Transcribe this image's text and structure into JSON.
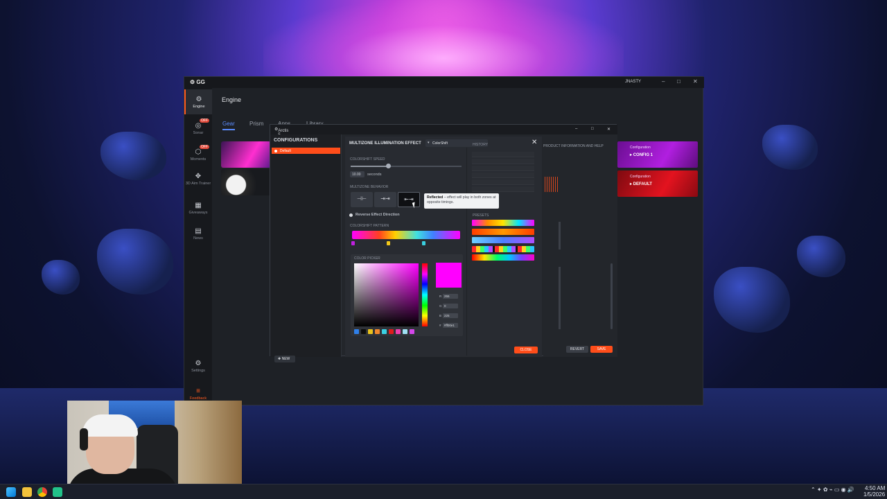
{
  "gg": {
    "logo": "GG",
    "user": "JNASTY",
    "window_controls": [
      "–",
      "□",
      "✕"
    ],
    "title": "Engine",
    "tabs": [
      "Gear",
      "Prism",
      "Apps",
      "Library"
    ],
    "nav": [
      {
        "label": "Engine",
        "icon": "engine-icon"
      },
      {
        "label": "Sonar",
        "icon": "sonar-icon",
        "badge": "OFF"
      },
      {
        "label": "Moments",
        "icon": "moments-icon",
        "badge": "OFF"
      },
      {
        "label": "3D Aim Trainer",
        "icon": "aim-trainer-icon"
      },
      {
        "label": "Giveaways",
        "icon": "gift-icon"
      },
      {
        "label": "News",
        "icon": "news-icon"
      },
      {
        "label": "Settings",
        "icon": "gear-icon"
      },
      {
        "label": "Feedback",
        "icon": "feedback-icon"
      }
    ],
    "config_cards": [
      {
        "label": "Configuration",
        "name": "CONFIG 1",
        "color": "#a21bd0"
      },
      {
        "label": "Configuration",
        "name": "DEFAULT",
        "color": "#d4121c"
      }
    ]
  },
  "dialog": {
    "title": "Arctis 5",
    "controls": [
      "–",
      "□",
      "✕"
    ],
    "configs_title": "CONFIGURATIONS",
    "selected_config": "Default",
    "new_label": "NEW",
    "product_info": "PRODUCT INFORMATION AND HELP",
    "revert_label": "REVERT",
    "save_label": "SAVE",
    "close_label": "CLOSE",
    "effect_heading": "MULTIZONE ILLUMINATION EFFECT",
    "effect_value": "ColorShift",
    "speed_label": "COLORSHIFT SPEED",
    "speed_fraction": 0.34,
    "speed_value": "10.00",
    "speed_unit": "seconds",
    "behavior_label": "MULTIZONE BEHAVIOR",
    "behavior_selected": 2,
    "tooltip_title": "Reflected",
    "tooltip_text": " – effect will play in both zones at opposite timings.",
    "reverse_label": "Reverse Effect Direction",
    "pattern_label": "COLORSHIFT PATTERN",
    "picker_label": "COLOR PICKER",
    "history_label": "HISTORY",
    "presets_label": "PRESETS",
    "rgb": {
      "r": "255",
      "g": "0",
      "b": "225",
      "hex": "#ff00e1"
    },
    "rgb_letters": {
      "r": "R",
      "g": "G",
      "b": "B",
      "hex": "#"
    },
    "swatches": [
      "#2f7fe8",
      "#0c0c0c",
      "#e9c21c",
      "#f0862c",
      "#3bd0e3",
      "#e01c1c",
      "#ef3fb0",
      "#9fe1f3",
      "#d447ea"
    ],
    "presets": [
      "linear-gradient(90deg,#ff00ff,#ff8a00,#ffe600,#00e5ff,#ff00ff)",
      "linear-gradient(90deg,#ff3d00,#ff9900,#ff3d00)",
      "linear-gradient(90deg,#6cd0ff,#4c7fff,#b04dff)",
      "repeating-linear-gradient(90deg,#ff2b2b 0 6px,#ffd21f 6px 12px,#3cff6a 12px 18px,#27c9ff 18px 24px,#b04dff 24px 30px,#111 30px 33px)",
      "linear-gradient(90deg,#ff0000,#ffe600,#00ff66,#00c8ff,#7a3dff,#ff00cc)"
    ]
  },
  "taskbar": {
    "time": "4:50 AM",
    "date": "1/5/2026"
  }
}
